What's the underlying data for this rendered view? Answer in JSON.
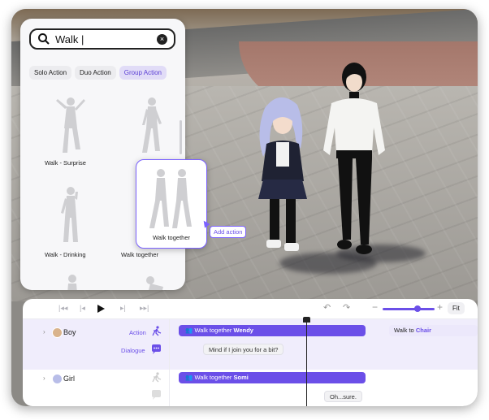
{
  "search": {
    "value": "Walk |",
    "clear_icon": "close-circle-icon"
  },
  "tabs": [
    {
      "label": "Solo Action",
      "active": false
    },
    {
      "label": "Duo Action",
      "active": false
    },
    {
      "label": "Group Action",
      "active": true
    }
  ],
  "library_items": [
    {
      "label": "Walk - Surprise"
    },
    {
      "label": ""
    },
    {
      "label": "Walk - Drinking"
    },
    {
      "label": "Walk together"
    }
  ],
  "drag_preview": {
    "label": "Walk together",
    "tooltip": "Add action"
  },
  "timeline": {
    "zoom_fit_label": "Fit",
    "zoom_level": 0.8,
    "tracks": [
      {
        "name": "Boy",
        "action_label": "Action",
        "dialogue_label": "Dialogue",
        "action_clip": {
          "prefix": "Walk together",
          "who": "Wendy"
        },
        "next_clip": {
          "prefix": "Walk to",
          "target": "Chair"
        },
        "dialogue_bubble": "Mind if I join you for a bit?"
      },
      {
        "name": "Girl",
        "action_clip": {
          "prefix": "Walk together",
          "who": "Somi"
        },
        "dialogue_bubble": "Oh...sure."
      }
    ]
  },
  "colors": {
    "accent": "#6b4fe8",
    "tab_active_bg": "#e1dcf7"
  }
}
